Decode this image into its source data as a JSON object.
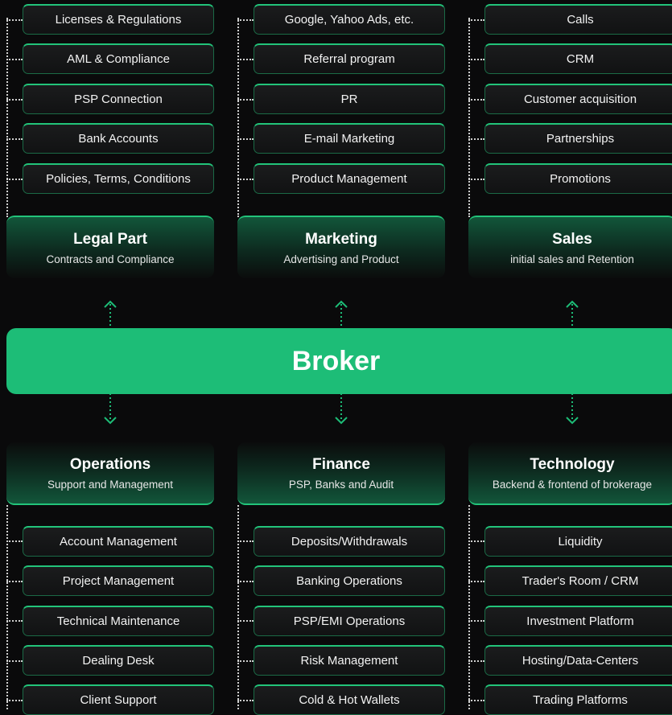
{
  "center": {
    "label": "Broker"
  },
  "top_sections": [
    {
      "title": "Legal Part",
      "subtitle": "Contracts and Compliance",
      "items": [
        "Licenses & Regulations",
        "AML & Compliance",
        "PSP Connection",
        "Bank Accounts",
        "Policies, Terms, Conditions"
      ]
    },
    {
      "title": "Marketing",
      "subtitle": "Advertising and Product",
      "items": [
        "Google, Yahoo Ads, etc.",
        "Referral program",
        "PR",
        "E-mail Marketing",
        "Product Management"
      ]
    },
    {
      "title": "Sales",
      "subtitle": "initial sales and Retention",
      "items": [
        "Calls",
        "CRM",
        "Customer acquisition",
        "Partnerships",
        "Promotions"
      ]
    }
  ],
  "bottom_sections": [
    {
      "title": "Operations",
      "subtitle": "Support and Management",
      "items": [
        "Account Management",
        "Project Management",
        "Technical Maintenance",
        "Dealing Desk",
        "Client Support"
      ]
    },
    {
      "title": "Finance",
      "subtitle": "PSP, Banks and Audit",
      "items": [
        "Deposits/Withdrawals",
        "Banking Operations",
        "PSP/EMI Operations",
        "Risk Management",
        "Cold & Hot Wallets"
      ]
    },
    {
      "title": "Technology",
      "subtitle": "Backend & frontend of brokerage",
      "items": [
        "Liquidity",
        "Trader's Room / CRM",
        "Investment Platform",
        "Hosting/Data-Centers",
        "Trading Platforms"
      ]
    }
  ],
  "colors": {
    "accent": "#1dbd77",
    "background": "#0a0a0b",
    "dots": "#cfcfcf"
  }
}
